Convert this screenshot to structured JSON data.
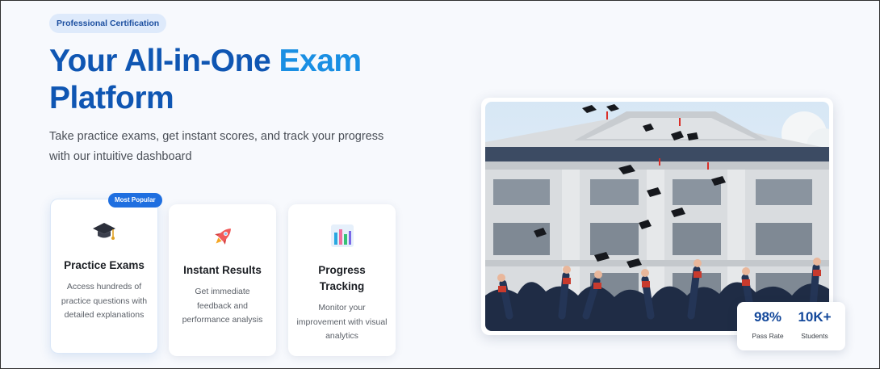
{
  "hero": {
    "badge": "Professional Certification",
    "title_main": "Your All-in-One",
    "title_accent": "Exam",
    "title_end": "Platform",
    "subtitle": "Take practice exams, get instant scores, and track your progress with our intuitive dashboard"
  },
  "features": [
    {
      "icon": "graduation-cap-icon",
      "title": "Practice Exams",
      "desc": "Access hundreds of practice questions with detailed explanations",
      "tag": "Most Popular"
    },
    {
      "icon": "rocket-icon",
      "title": "Instant Results",
      "desc": "Get immediate feedback and performance analysis"
    },
    {
      "icon": "bar-chart-icon",
      "title": "Progress Tracking",
      "desc": "Monitor your improvement with visual analytics"
    }
  ],
  "stats": [
    {
      "value": "98%",
      "label": "Pass Rate"
    },
    {
      "value": "10K+",
      "label": "Students"
    }
  ],
  "colors": {
    "primary": "#0f56b3",
    "accent": "#1a8fe3",
    "badge_bg": "#deeafb",
    "popular_bg": "#1f6fe0"
  }
}
